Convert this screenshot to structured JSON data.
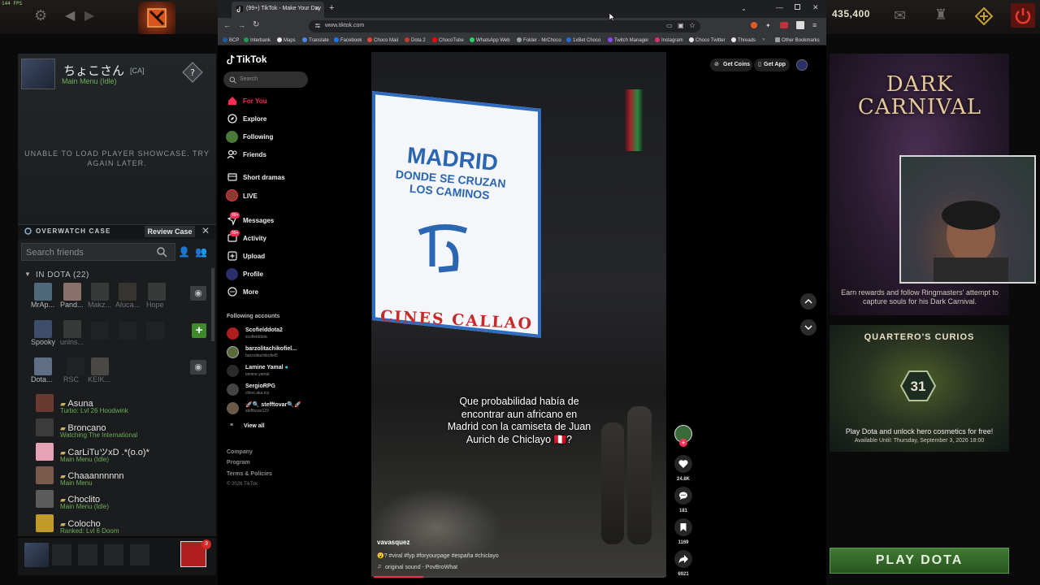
{
  "overlay": {
    "fps": "144 FPS"
  },
  "dota": {
    "gold": "435,400",
    "profile": {
      "name": "ちょこさん",
      "tag": "[CA]",
      "status": "Main Menu (Idle)"
    },
    "showcase_msg": "UNABLE TO LOAD PLAYER SHOWCASE. TRY AGAIN LATER.",
    "overwatch": {
      "label": "OVERWATCH CASE",
      "button": "Review Case"
    },
    "friends_search_placeholder": "Search friends",
    "in_dota_header": "IN DOTA (22)",
    "grid_friends": [
      {
        "name": "MrAp...",
        "dim": false
      },
      {
        "name": "Pand...",
        "dim": false
      },
      {
        "name": "Makz...",
        "dim": true
      },
      {
        "name": "Aluca...",
        "dim": true
      },
      {
        "name": "Hope",
        "dim": true
      },
      {
        "name": "Spooky",
        "dim": false
      },
      {
        "name": "unins...",
        "dim": true
      },
      {
        "name": "Dota...",
        "dim": false
      },
      {
        "name": "RSC",
        "dim": true
      },
      {
        "name": "KEIK...",
        "dim": true
      }
    ],
    "list_friends": [
      {
        "name": "Asuna",
        "sub": "Turbo: Lvl 26 Hoodwink",
        "color": "green"
      },
      {
        "name": "Broncano",
        "sub": "Watching The International",
        "color": "green"
      },
      {
        "name": "CarLiTuツxD .*(o.o)*",
        "sub": "Main Menu (Idle)",
        "color": "green"
      },
      {
        "name": "Chaaannnnnn",
        "sub": "Main Menu",
        "color": "green"
      },
      {
        "name": "Choclito",
        "sub": "Main Menu (Idle)",
        "color": "green"
      },
      {
        "name": "Colocho",
        "sub": "Ranked: Lvl 6 Doom",
        "color": "green"
      }
    ],
    "notif_count": "3",
    "carnival": {
      "title_line1": "DARK",
      "title_line2": "CARNIVAL",
      "caption": "Earn rewards and follow Ringmasters' attempt to capture souls for his Dark Carnival."
    },
    "curios": {
      "title": "QUARTERO'S CURIOS",
      "badge": "31",
      "cta": "Play Dota and unlock hero cosmetics for free!",
      "until": "Available Until:  Thursday, September 3, 2026 18:00"
    },
    "play_button": "PLAY DOTA"
  },
  "browser": {
    "tab_title": "(99+) TikTok - Make Your Day",
    "url": "www.tiktok.com",
    "bookmarks": [
      "BCP",
      "Interbank",
      "Maps",
      "Translate",
      "Facebook",
      "Choco Mail",
      "Dota 2",
      "ChocoTube",
      "WhatsApp Web",
      "Folder - MrChoco",
      "1xBet Choco",
      "Twitch Manager",
      "Instagram",
      "Choco Twitter",
      "Threads",
      "Other Bookmarks"
    ],
    "bookmark_colors": [
      "#1b5ea8",
      "#1f9a51",
      "#e8e8e8",
      "#4a88e8",
      "#1877f2",
      "#ea4335",
      "#c23c2a",
      "#ff0000",
      "#25d366",
      "#9aa0a6",
      "#1e6fd9",
      "#9146ff",
      "#e1306c",
      "#e8e8e8",
      "#e8e8e8",
      "#9aa0a6"
    ]
  },
  "tiktok": {
    "logo": "TikTok",
    "search_placeholder": "Search",
    "nav": [
      {
        "label": "For You",
        "icon": "home-icon",
        "active": true
      },
      {
        "label": "Explore",
        "icon": "compass-icon",
        "active": false
      },
      {
        "label": "Following",
        "icon": "following-avatar-icon",
        "active": false
      },
      {
        "label": "Friends",
        "icon": "friends-icon",
        "active": false
      },
      {
        "label": "Short dramas",
        "icon": "drama-icon",
        "active": false
      },
      {
        "label": "LIVE",
        "icon": "live-avatar-icon",
        "active": false
      },
      {
        "label": "Messages",
        "icon": "messages-icon",
        "active": false,
        "badge": "99+"
      },
      {
        "label": "Activity",
        "icon": "activity-icon",
        "active": false,
        "badge": "99+"
      },
      {
        "label": "Upload",
        "icon": "upload-icon",
        "active": false
      },
      {
        "label": "Profile",
        "icon": "profile-avatar-icon",
        "active": false
      },
      {
        "label": "More",
        "icon": "more-icon",
        "active": false
      }
    ],
    "following_header": "Following accounts",
    "accounts": [
      {
        "name": "Scofielddota2",
        "handle": "scofielddota"
      },
      {
        "name": "barzolitachikofiel...",
        "handle": "barzolitachikofiel5"
      },
      {
        "name": "Lamine Yamal",
        "handle": "lamine.yamal"
      },
      {
        "name": "SergioRPG",
        "handle": "chino.aka.toy"
      },
      {
        "name": "🚀🔍 stefftovar🔍🚀",
        "handle": "stefftovar123"
      }
    ],
    "view_all": "View all",
    "footer": [
      "Company",
      "Program",
      "Terms & Policies",
      "© 2026 TikTok"
    ],
    "top_actions": {
      "coins": "Get Coins",
      "app": "Get App"
    },
    "video": {
      "billboard_line1": "MADRID",
      "billboard_line2": "DONDE SE CRUZAN\nLOS CAMINOS",
      "cines": "CINES  CALLAO",
      "caption": "Que probabilidad había de encontrar aun africano en Madrid con la camiseta de Juan Aurich de Chiclayo 🇵🇪?",
      "author": "vavasquez",
      "hashtags": "😮? #viral #fyp #foryourpage #españa #chiclayo",
      "sound": "original sound - PovBroWhat",
      "progress_fraction": 0.17
    },
    "actions": [
      {
        "icon": "heart-icon",
        "count": "24.8K"
      },
      {
        "icon": "comment-icon",
        "count": "181"
      },
      {
        "icon": "bookmark-icon",
        "count": "1169"
      },
      {
        "icon": "share-icon",
        "count": "6921"
      }
    ]
  }
}
